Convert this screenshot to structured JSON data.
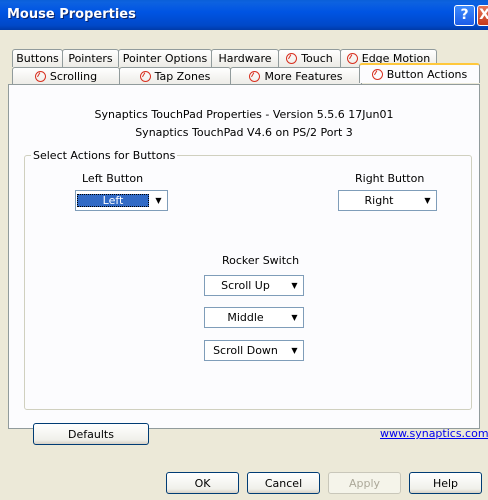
{
  "window": {
    "title": "Mouse Properties",
    "help_glyph": "?",
    "close_glyph": "X"
  },
  "tabs_row1": [
    {
      "label": "Buttons"
    },
    {
      "label": "Pointers"
    },
    {
      "label": "Pointer Options"
    },
    {
      "label": "Hardware"
    },
    {
      "label": "Touch"
    },
    {
      "label": "Edge Motion"
    }
  ],
  "tabs_row2": [
    {
      "label": "Scrolling"
    },
    {
      "label": "Tap Zones"
    },
    {
      "label": "More Features"
    },
    {
      "label": "Button Actions"
    }
  ],
  "info": {
    "line1": "Synaptics TouchPad Properties - Version 5.5.6 17Jun01",
    "line2": "Synaptics TouchPad V4.6 on PS/2 Port 3"
  },
  "group": {
    "legend": "Select Actions for Buttons",
    "left_label": "Left Button",
    "left_value": "Left",
    "right_label": "Right Button",
    "right_value": "Right",
    "rocker_label": "Rocker Switch",
    "rocker_values": [
      "Scroll Up",
      "Middle",
      "Scroll Down"
    ]
  },
  "defaults_label": "Defaults",
  "link_text": "www.synaptics.com",
  "dialog_buttons": {
    "ok": "OK",
    "cancel": "Cancel",
    "apply": "Apply",
    "help": "Help"
  },
  "colors": {
    "accent": "#0054e3",
    "tab_highlight": "#ffc83c",
    "selection": "#316ac5"
  },
  "icons": {
    "synaptics": "synaptics-icon",
    "dropdown": "chevron-down-icon"
  }
}
